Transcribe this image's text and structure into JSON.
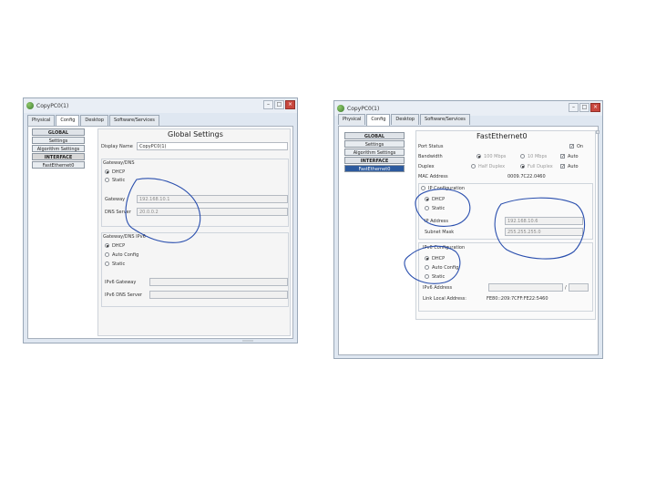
{
  "left_window": {
    "title": "CopyPC0(1)",
    "tabs": [
      "Physical",
      "Config",
      "Desktop",
      "Software/Services"
    ],
    "active_tab": "Config",
    "sidebar": [
      "GLOBAL",
      "Settings",
      "Algorithm Settings",
      "INTERFACE",
      "FastEthernet0"
    ],
    "heading": "Global Settings",
    "display_name_label": "Display Name",
    "display_name_value": "CopyPC0(1)",
    "gateway_dns_label": "Gateway/DNS",
    "dhcp_label": "DHCP",
    "static_label": "Static",
    "gateway_label": "Gateway",
    "gateway_value": "192.168.10.1",
    "dns_label": "DNS Server",
    "dns_value": "20.0.0.2",
    "ipv6_section_label": "Gateway/DNS IPv6",
    "auto_config_label": "Auto Config",
    "ipv6_gateway_label": "IPv6 Gateway",
    "ipv6_dns_label": "IPv6 DNS Server"
  },
  "right_window": {
    "title": "CopyPC0(1)",
    "tabs": [
      "Physical",
      "Config",
      "Desktop",
      "Software/Services"
    ],
    "active_tab": "Config",
    "sidebar": [
      "GLOBAL",
      "Settings",
      "Algorithm Settings",
      "INTERFACE",
      "FastEthernet0"
    ],
    "heading": "FastEthernet0",
    "port_status_label": "Port Status",
    "on_label": "On",
    "bandwidth_label": "Bandwidth",
    "bw_100": "100 Mbps",
    "bw_10": "10 Mbps",
    "auto_label": "Auto",
    "duplex_label": "Duplex",
    "half_duplex": "Half Duplex",
    "full_duplex": "Full Duplex",
    "mac_label": "MAC Address",
    "mac_value": "0009.7C22.0460",
    "ip_config_label": "IP Configuration",
    "dhcp_label": "DHCP",
    "static_label": "Static",
    "ip_label": "IP Address",
    "ip_value": "192.168.10.6",
    "mask_label": "Subnet Mask",
    "mask_value": "255.255.255.0",
    "ipv6_config_label": "IPv6 Configuration",
    "auto_config_label": "Auto Config",
    "ipv6_addr_label": "IPv6 Address",
    "ipv6_prefix_sep": "/",
    "link_local_label": "Link Local Address:",
    "link_local_value": "FE80::209:7CFF:FE22:5460"
  },
  "colors": {
    "annotation_ink": "#2a4fae",
    "sidebar_highlight": "#2c5a9e",
    "close_button": "#c9473e"
  }
}
